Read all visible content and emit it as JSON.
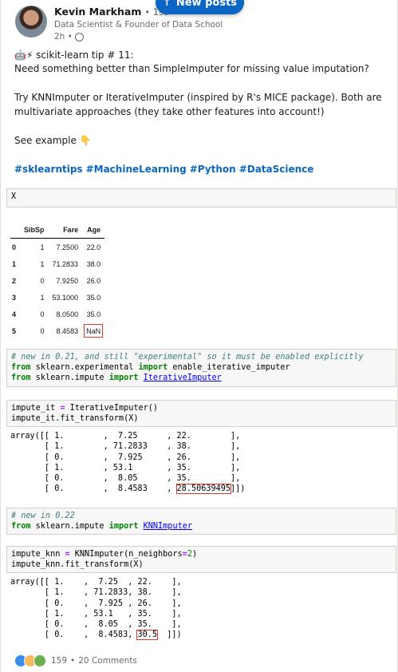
{
  "author": {
    "name": "Kevin Markham",
    "degree": "• 1st",
    "headline": "Data Scientist & Founder of Data School",
    "time": "2h •"
  },
  "new_posts_label": "New posts",
  "post": {
    "line1": "🤖⚡ scikit-learn tip # 11:",
    "line2": "Need something better than SimpleImputer for missing value imputation?",
    "line3": "Try KNNImputer or IterativeImputer (inspired by R's MICE package). Both are",
    "line4": "multivariate approaches (they take other features into account!)",
    "line5": "See example 👇",
    "hashtags": [
      "#sklearntips",
      "#MachineLearning",
      "#Python",
      "#DataScience"
    ]
  },
  "notebook": {
    "cell_x": "X",
    "dataframe": {
      "columns": [
        "SibSp",
        "Fare",
        "Age"
      ],
      "rows": [
        {
          "index": "0",
          "SibSp": "1",
          "Fare": "7.2500",
          "Age": "22.0"
        },
        {
          "index": "1",
          "SibSp": "1",
          "Fare": "71.2833",
          "Age": "38.0"
        },
        {
          "index": "2",
          "SibSp": "0",
          "Fare": "7.9250",
          "Age": "26.0"
        },
        {
          "index": "3",
          "SibSp": "1",
          "Fare": "53.1000",
          "Age": "35.0"
        },
        {
          "index": "4",
          "SibSp": "0",
          "Fare": "8.0500",
          "Age": "35.0"
        },
        {
          "index": "5",
          "SibSp": "0",
          "Fare": "8.4583",
          "Age": "NaN"
        }
      ]
    },
    "cell_iterative_import": {
      "comment": "# new in 0.21, and still \"experimental\" so it must be enabled explicitly",
      "line2_kw1": "from",
      "line2_mod": " sklearn.experimental ",
      "line2_kw2": "import",
      "line2_name": " enable_iterative_imputer",
      "line3_kw1": "from",
      "line3_mod": " sklearn.impute ",
      "line3_kw2": "import",
      "line3_name": "IterativeImputer"
    },
    "cell_iterative_run": {
      "line1_a": "impute_it ",
      "line1_op": "=",
      "line1_b": " IterativeImputer()",
      "line2": "impute_it.fit_transform(X)"
    },
    "output_iterative": {
      "rows": [
        "array([[ 1.        ,  7.25      , 22.        ],",
        "       [ 1.        , 71.2833    , 38.        ],",
        "       [ 0.        ,  7.925     , 26.        ],",
        "       [ 1.        , 53.1       , 35.        ],",
        "       [ 0.        ,  8.05      , 35.        ],"
      ],
      "last_prefix": "       [ 0.        ,  8.4583    , ",
      "last_value": "28.50639495",
      "last_suffix": "]])"
    },
    "cell_knn_import": {
      "comment": "# new in 0.22",
      "kw1": "from",
      "mod": " sklearn.impute ",
      "kw2": "import",
      "name": "KNNImputer"
    },
    "cell_knn_run": {
      "line1_a": "impute_knn ",
      "line1_op": "=",
      "line1_b": " KNNImputer(n_neighbors",
      "line1_op2": "=",
      "line1_num": "2",
      "line1_c": ")",
      "line2": "impute_knn.fit_transform(X)"
    },
    "output_knn": {
      "rows": [
        "array([[ 1.    ,  7.25  , 22.    ],",
        "       [ 1.    , 71.2833, 38.    ],",
        "       [ 0.    ,  7.925 , 26.    ],",
        "       [ 1.    , 53.1   , 35.    ],",
        "       [ 0.    ,  8.05  , 35.    ],"
      ],
      "last_prefix": "       [ 0.    ,  8.4583, ",
      "last_value": "30.5",
      "last_suffix": "  ]])"
    }
  },
  "social": {
    "reaction_count": "159",
    "separator": "•",
    "comments": "20 Comments"
  },
  "colors": {
    "linkedin_blue": "#0a66c2",
    "highlight_red": "#e03a2e",
    "code_bg": "#f7f7f7"
  }
}
